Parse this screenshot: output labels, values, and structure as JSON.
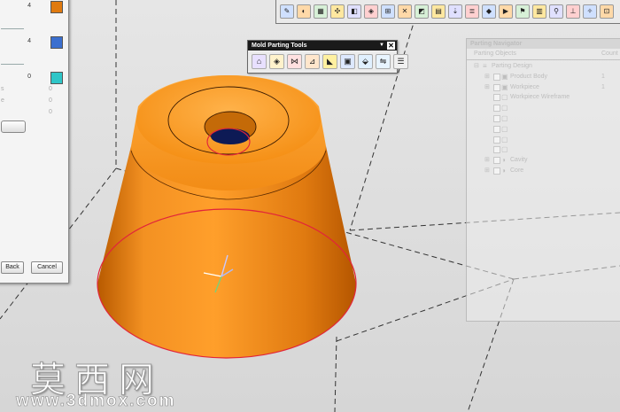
{
  "left_dialog": {
    "rows": [
      {
        "value": "4",
        "color": "#e07a10"
      },
      {
        "value": "4",
        "color": "#3b6fcf"
      },
      {
        "value": "0",
        "color": "#2fc6c8"
      }
    ],
    "extra_rows": [
      {
        "label": "s",
        "value": "0"
      },
      {
        "label": "e",
        "value": "0"
      },
      {
        "label": "",
        "value": "0"
      }
    ],
    "back_label": "Back",
    "cancel_label": "Cancel"
  },
  "mold_parting_tools": {
    "title": "Mold Parting Tools",
    "menu_glyph": "▼",
    "close_glyph": "✕",
    "tools": [
      {
        "icon": "region-icon",
        "glyph": "⌂"
      },
      {
        "icon": "patch-icon",
        "glyph": "◈"
      },
      {
        "icon": "parting-line-icon",
        "glyph": "⋈"
      },
      {
        "icon": "edit-parting-icon",
        "glyph": "⊿"
      },
      {
        "icon": "parting-surface-icon",
        "glyph": "◣"
      },
      {
        "icon": "define-cavity-icon",
        "glyph": "▣"
      },
      {
        "icon": "transfer-region-icon",
        "glyph": "⬙"
      },
      {
        "icon": "swap-model-icon",
        "glyph": "⇋"
      },
      {
        "icon": "navigator-icon",
        "glyph": "☰"
      }
    ]
  },
  "top_toolbar": {
    "tools": [
      "✎",
      "◐",
      "▦",
      "✣",
      "◧",
      "◈",
      "⊞",
      "✕",
      "◩",
      "▤",
      "⇣",
      "≣",
      "◆",
      "▶",
      "⚑",
      "▥",
      "⚲",
      "⊥",
      "✧",
      "⊡"
    ]
  },
  "parting_navigator": {
    "title": "Parting Navigator",
    "col_objects": "Parting Objects",
    "col_count": "Count",
    "items": [
      {
        "label": "Parting Design",
        "count": "",
        "level": 0,
        "expand": "⊟",
        "icon": "≡"
      },
      {
        "label": "Product Body",
        "count": "1",
        "level": 1,
        "expand": "⊞",
        "icon": "▣"
      },
      {
        "label": "Workpiece",
        "count": "1",
        "level": 1,
        "expand": "⊞",
        "icon": "▣"
      },
      {
        "label": "Workpiece Wireframe",
        "count": "",
        "level": 1,
        "expand": "",
        "icon": "▢"
      },
      {
        "label": "",
        "count": "",
        "level": 1,
        "expand": "",
        "icon": "▢"
      },
      {
        "label": "",
        "count": "",
        "level": 1,
        "expand": "",
        "icon": "▢"
      },
      {
        "label": "",
        "count": "",
        "level": 1,
        "expand": "",
        "icon": "▢"
      },
      {
        "label": "",
        "count": "",
        "level": 1,
        "expand": "",
        "icon": "▢"
      },
      {
        "label": "",
        "count": "",
        "level": 1,
        "expand": "",
        "icon": "▢"
      },
      {
        "label": "Cavity",
        "count": "",
        "level": 1,
        "expand": "⊞",
        "icon": "◑"
      },
      {
        "label": "Core",
        "count": "",
        "level": 1,
        "expand": "⊞",
        "icon": "◑"
      }
    ]
  },
  "watermark": {
    "chinese": "莫西网",
    "url": "www.3dmox.com"
  },
  "colors": {
    "part_orange": "#f08a10",
    "part_dark": "#b85a00",
    "edge_red": "#e2253a"
  }
}
